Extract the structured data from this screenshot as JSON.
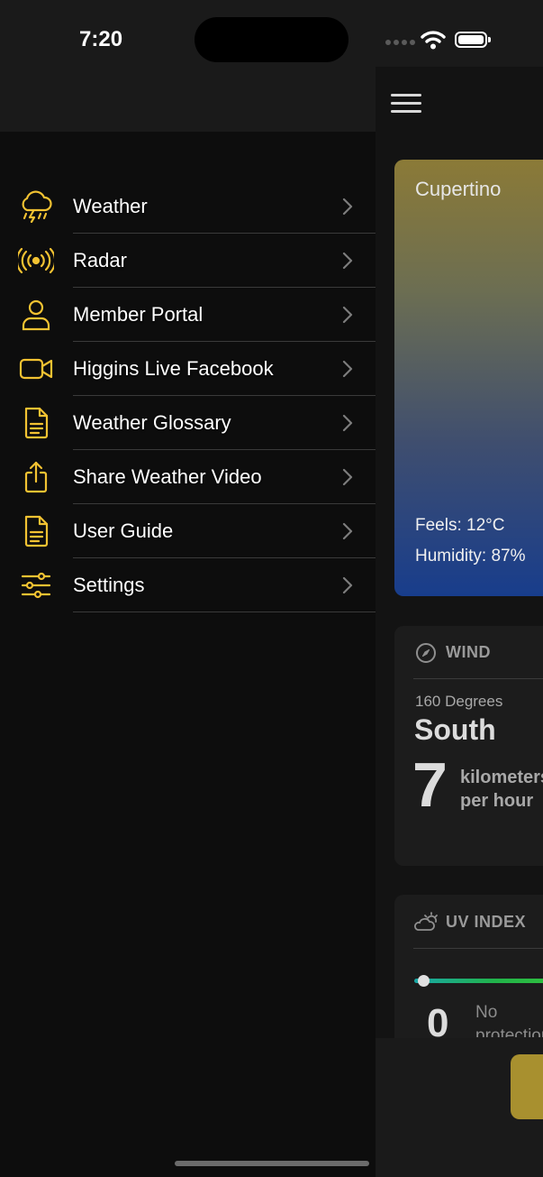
{
  "status_bar": {
    "time": "7:20"
  },
  "menu": {
    "accent": "#f2c232",
    "items": [
      {
        "label": "Weather",
        "icon": "thunderstorm-cloud-icon"
      },
      {
        "label": "Radar",
        "icon": "radar-broadcast-icon"
      },
      {
        "label": "Member Portal",
        "icon": "person-icon"
      },
      {
        "label": "Higgins Live Facebook",
        "icon": "video-camera-icon"
      },
      {
        "label": "Weather Glossary",
        "icon": "document-icon"
      },
      {
        "label": "Share Weather Video",
        "icon": "share-icon"
      },
      {
        "label": "User Guide",
        "icon": "document-icon"
      },
      {
        "label": "Settings",
        "icon": "sliders-icon"
      }
    ]
  },
  "weather_card": {
    "city": "Cupertino",
    "feels": "Feels: 12°C",
    "humidity": "Humidity: 87%"
  },
  "wind_card": {
    "title": "WIND",
    "degrees": "160 Degrees",
    "direction": "South",
    "speed": "7",
    "unit": "kilometers per hour"
  },
  "uv_card": {
    "title": "UV INDEX",
    "value": "0",
    "description": "No protection needed outside",
    "level": 0
  }
}
